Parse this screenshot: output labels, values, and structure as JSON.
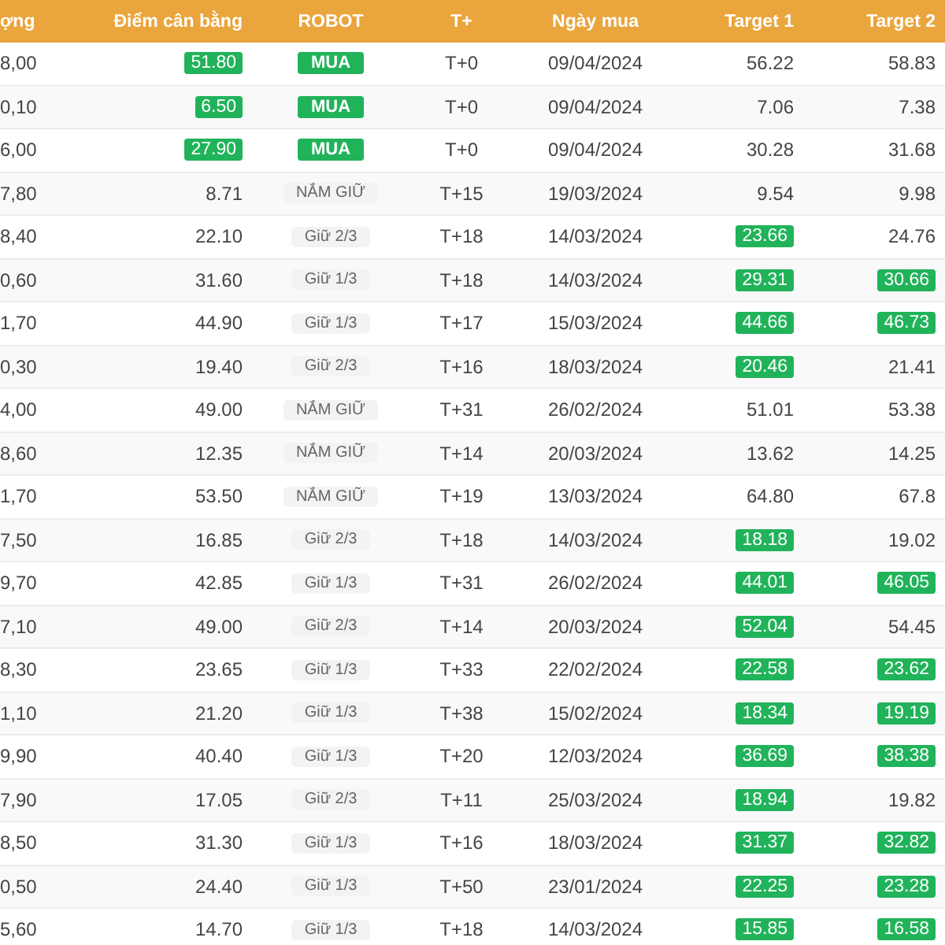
{
  "table": {
    "columns": [
      "ợng",
      "Điểm cân bằng",
      "ROBOT",
      "T+",
      "Ngày mua",
      "Target 1",
      "Target 2"
    ],
    "rows": [
      {
        "volume": "8,00",
        "balance": {
          "value": "51.80",
          "hit": true
        },
        "robot": {
          "label": "MUA",
          "kind": "buy"
        },
        "t": "T+0",
        "date": "09/04/2024",
        "target1": {
          "value": "56.22",
          "hit": false
        },
        "target2": {
          "value": "58.83",
          "hit": false
        }
      },
      {
        "volume": "0,10",
        "balance": {
          "value": "6.50",
          "hit": true
        },
        "robot": {
          "label": "MUA",
          "kind": "buy"
        },
        "t": "T+0",
        "date": "09/04/2024",
        "target1": {
          "value": "7.06",
          "hit": false
        },
        "target2": {
          "value": "7.38",
          "hit": false
        }
      },
      {
        "volume": "6,00",
        "balance": {
          "value": "27.90",
          "hit": true
        },
        "robot": {
          "label": "MUA",
          "kind": "buy"
        },
        "t": "T+0",
        "date": "09/04/2024",
        "target1": {
          "value": "30.28",
          "hit": false
        },
        "target2": {
          "value": "31.68",
          "hit": false
        }
      },
      {
        "volume": "7,80",
        "balance": {
          "value": "8.71",
          "hit": false
        },
        "robot": {
          "label": "NẮM GIỮ",
          "kind": "hold"
        },
        "t": "T+15",
        "date": "19/03/2024",
        "target1": {
          "value": "9.54",
          "hit": false
        },
        "target2": {
          "value": "9.98",
          "hit": false
        }
      },
      {
        "volume": "8,40",
        "balance": {
          "value": "22.10",
          "hit": false
        },
        "robot": {
          "label": "Giữ 2/3",
          "kind": "hold"
        },
        "t": "T+18",
        "date": "14/03/2024",
        "target1": {
          "value": "23.66",
          "hit": true
        },
        "target2": {
          "value": "24.76",
          "hit": false
        }
      },
      {
        "volume": "0,60",
        "balance": {
          "value": "31.60",
          "hit": false
        },
        "robot": {
          "label": "Giữ 1/3",
          "kind": "hold"
        },
        "t": "T+18",
        "date": "14/03/2024",
        "target1": {
          "value": "29.31",
          "hit": true
        },
        "target2": {
          "value": "30.66",
          "hit": true
        }
      },
      {
        "volume": "1,70",
        "balance": {
          "value": "44.90",
          "hit": false
        },
        "robot": {
          "label": "Giữ 1/3",
          "kind": "hold"
        },
        "t": "T+17",
        "date": "15/03/2024",
        "target1": {
          "value": "44.66",
          "hit": true
        },
        "target2": {
          "value": "46.73",
          "hit": true
        }
      },
      {
        "volume": "0,30",
        "balance": {
          "value": "19.40",
          "hit": false
        },
        "robot": {
          "label": "Giữ 2/3",
          "kind": "hold"
        },
        "t": "T+16",
        "date": "18/03/2024",
        "target1": {
          "value": "20.46",
          "hit": true
        },
        "target2": {
          "value": "21.41",
          "hit": false
        }
      },
      {
        "volume": "4,00",
        "balance": {
          "value": "49.00",
          "hit": false
        },
        "robot": {
          "label": "NẮM GIỮ",
          "kind": "hold"
        },
        "t": "T+31",
        "date": "26/02/2024",
        "target1": {
          "value": "51.01",
          "hit": false
        },
        "target2": {
          "value": "53.38",
          "hit": false
        }
      },
      {
        "volume": "8,60",
        "balance": {
          "value": "12.35",
          "hit": false
        },
        "robot": {
          "label": "NẮM GIỮ",
          "kind": "hold"
        },
        "t": "T+14",
        "date": "20/03/2024",
        "target1": {
          "value": "13.62",
          "hit": false
        },
        "target2": {
          "value": "14.25",
          "hit": false
        }
      },
      {
        "volume": "1,70",
        "balance": {
          "value": "53.50",
          "hit": false
        },
        "robot": {
          "label": "NẮM GIỮ",
          "kind": "hold"
        },
        "t": "T+19",
        "date": "13/03/2024",
        "target1": {
          "value": "64.80",
          "hit": false
        },
        "target2": {
          "value": "67.8",
          "hit": false
        }
      },
      {
        "volume": "7,50",
        "balance": {
          "value": "16.85",
          "hit": false
        },
        "robot": {
          "label": "Giữ 2/3",
          "kind": "hold"
        },
        "t": "T+18",
        "date": "14/03/2024",
        "target1": {
          "value": "18.18",
          "hit": true
        },
        "target2": {
          "value": "19.02",
          "hit": false
        }
      },
      {
        "volume": "9,70",
        "balance": {
          "value": "42.85",
          "hit": false
        },
        "robot": {
          "label": "Giữ 1/3",
          "kind": "hold"
        },
        "t": "T+31",
        "date": "26/02/2024",
        "target1": {
          "value": "44.01",
          "hit": true
        },
        "target2": {
          "value": "46.05",
          "hit": true
        }
      },
      {
        "volume": "7,10",
        "balance": {
          "value": "49.00",
          "hit": false
        },
        "robot": {
          "label": "Giữ 2/3",
          "kind": "hold"
        },
        "t": "T+14",
        "date": "20/03/2024",
        "target1": {
          "value": "52.04",
          "hit": true
        },
        "target2": {
          "value": "54.45",
          "hit": false
        }
      },
      {
        "volume": "8,30",
        "balance": {
          "value": "23.65",
          "hit": false
        },
        "robot": {
          "label": "Giữ 1/3",
          "kind": "hold"
        },
        "t": "T+33",
        "date": "22/02/2024",
        "target1": {
          "value": "22.58",
          "hit": true
        },
        "target2": {
          "value": "23.62",
          "hit": true
        }
      },
      {
        "volume": "1,10",
        "balance": {
          "value": "21.20",
          "hit": false
        },
        "robot": {
          "label": "Giữ 1/3",
          "kind": "hold"
        },
        "t": "T+38",
        "date": "15/02/2024",
        "target1": {
          "value": "18.34",
          "hit": true
        },
        "target2": {
          "value": "19.19",
          "hit": true
        }
      },
      {
        "volume": "9,90",
        "balance": {
          "value": "40.40",
          "hit": false
        },
        "robot": {
          "label": "Giữ 1/3",
          "kind": "hold"
        },
        "t": "T+20",
        "date": "12/03/2024",
        "target1": {
          "value": "36.69",
          "hit": true
        },
        "target2": {
          "value": "38.38",
          "hit": true
        }
      },
      {
        "volume": "7,90",
        "balance": {
          "value": "17.05",
          "hit": false
        },
        "robot": {
          "label": "Giữ 2/3",
          "kind": "hold"
        },
        "t": "T+11",
        "date": "25/03/2024",
        "target1": {
          "value": "18.94",
          "hit": true
        },
        "target2": {
          "value": "19.82",
          "hit": false
        }
      },
      {
        "volume": "8,50",
        "balance": {
          "value": "31.30",
          "hit": false
        },
        "robot": {
          "label": "Giữ 1/3",
          "kind": "hold"
        },
        "t": "T+16",
        "date": "18/03/2024",
        "target1": {
          "value": "31.37",
          "hit": true
        },
        "target2": {
          "value": "32.82",
          "hit": true
        }
      },
      {
        "volume": "0,50",
        "balance": {
          "value": "24.40",
          "hit": false
        },
        "robot": {
          "label": "Giữ 1/3",
          "kind": "hold"
        },
        "t": "T+50",
        "date": "23/01/2024",
        "target1": {
          "value": "22.25",
          "hit": true
        },
        "target2": {
          "value": "23.28",
          "hit": true
        }
      },
      {
        "volume": "5,60",
        "balance": {
          "value": "14.70",
          "hit": false
        },
        "robot": {
          "label": "Giữ 1/3",
          "kind": "hold"
        },
        "t": "T+18",
        "date": "14/03/2024",
        "target1": {
          "value": "15.85",
          "hit": true
        },
        "target2": {
          "value": "16.58",
          "hit": true
        }
      }
    ]
  }
}
